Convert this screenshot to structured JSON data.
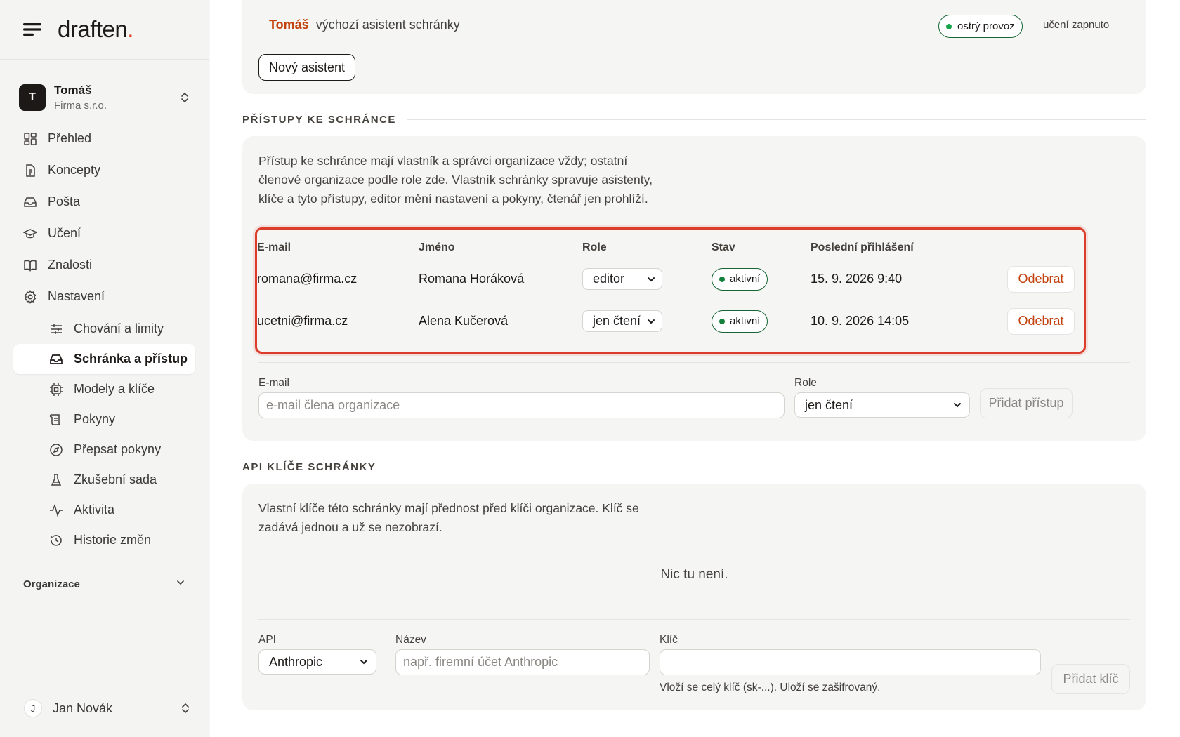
{
  "brand": {
    "name": "draften",
    "dot": "."
  },
  "account": {
    "initial": "T",
    "name": "Tomáš",
    "org": "Firma s.r.o."
  },
  "nav": [
    {
      "label": "Přehled",
      "icon": "dashboard-icon"
    },
    {
      "label": "Koncepty",
      "icon": "document-icon"
    },
    {
      "label": "Pošta",
      "icon": "inbox-icon"
    },
    {
      "label": "Učení",
      "icon": "graduation-cap-icon"
    },
    {
      "label": "Znalosti",
      "icon": "book-icon"
    },
    {
      "label": "Nastavení",
      "icon": "gear-icon"
    }
  ],
  "subnav": [
    {
      "label": "Chování a limity",
      "icon": "sliders-icon"
    },
    {
      "label": "Schránka a přístup",
      "icon": "inbox-icon",
      "active": true
    },
    {
      "label": "Modely a klíče",
      "icon": "chip-icon"
    },
    {
      "label": "Pokyny",
      "icon": "scroll-icon"
    },
    {
      "label": "Přepsat pokyny",
      "icon": "compass-icon"
    },
    {
      "label": "Zkušební sada",
      "icon": "flask-icon"
    },
    {
      "label": "Aktivita",
      "icon": "activity-icon"
    },
    {
      "label": "Historie změn",
      "icon": "history-icon"
    }
  ],
  "org_group": {
    "label": "Organizace"
  },
  "user": {
    "initial": "J",
    "name": "Jan Novák"
  },
  "assistant": {
    "name": "Tomáš",
    "desc": "výchozí asistent schránky",
    "status": "ostrý provoz",
    "learning": "učení zapnuto",
    "new_button": "Nový asistent"
  },
  "access": {
    "heading": "PŘÍSTUPY KE SCHRÁNCE",
    "intro": "Přístup ke schránce mají vlastník a správci organizace vždy; ostatní členové organizace podle role zde. Vlastník schránky spravuje asistenty, klíče a tyto přístupy, editor mění nastavení a pokyny, čtenář jen prohlíží.",
    "columns": [
      "E-mail",
      "Jméno",
      "Role",
      "Stav",
      "Poslední přihlášení"
    ],
    "rows": [
      {
        "email": "romana@firma.cz",
        "name": "Romana Horáková",
        "role": "editor",
        "status": "aktivní",
        "last_login": "15. 9. 2026 9:40",
        "action": "Odebrat"
      },
      {
        "email": "ucetni@firma.cz",
        "name": "Alena Kučerová",
        "role": "jen čtení",
        "status": "aktivní",
        "last_login": "10. 9. 2026 14:05",
        "action": "Odebrat"
      }
    ],
    "form": {
      "email_label": "E-mail",
      "email_placeholder": "e-mail člena organizace",
      "role_label": "Role",
      "role_value": "jen čtení",
      "submit": "Přidat přístup"
    }
  },
  "api": {
    "heading": "API KLÍČE SCHRÁNKY",
    "intro": "Vlastní klíče této schránky mají přednost před klíči organizace. Klíč se zadává jednou a už se nezobrazí.",
    "empty": "Nic tu není.",
    "form": {
      "api_label": "API",
      "api_value": "Anthropic",
      "name_label": "Název",
      "name_placeholder": "např. firemní účet Anthropic",
      "key_label": "Klíč",
      "key_hint": "Vloží se celý klíč (sk-...). Uloží se zašifrovaný.",
      "submit": "Přidat klíč"
    }
  },
  "colors": {
    "accent": "#dc3c1e",
    "status_green": "#16a34a",
    "danger": "#c2410c"
  }
}
